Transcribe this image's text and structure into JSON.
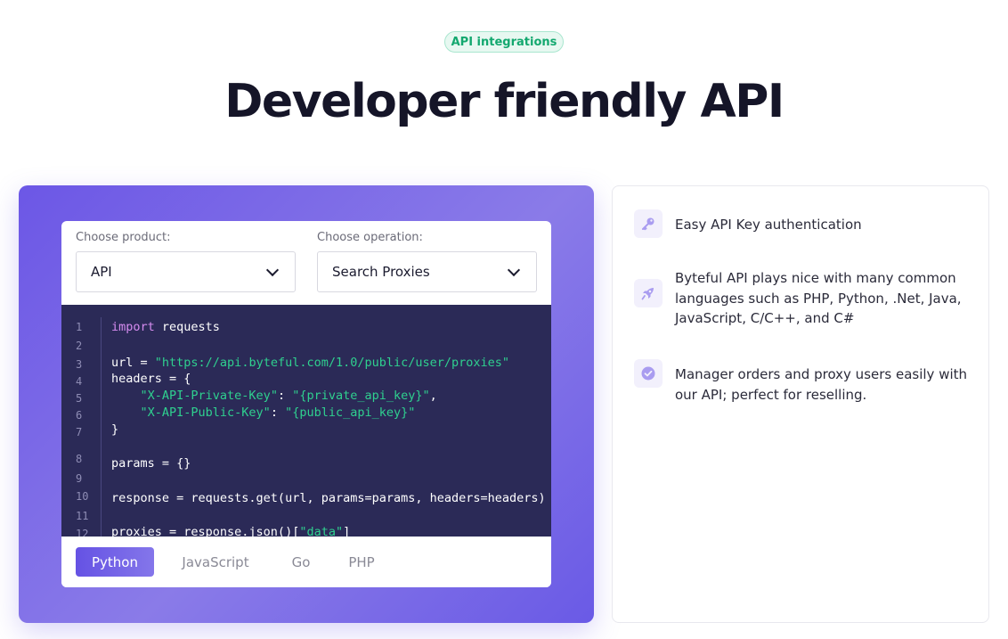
{
  "header": {
    "badge": "API integrations",
    "title": "Developer friendly API"
  },
  "selectors": {
    "product_label": "Choose product:",
    "product_value": "API",
    "operation_label": "Choose operation:",
    "operation_value": "Search Proxies"
  },
  "code": {
    "line_numbers": [
      "1",
      "2",
      "3",
      "4",
      "5",
      "6",
      "7",
      "8",
      "9",
      "10",
      "11",
      "12"
    ],
    "lines": [
      [
        {
          "t": "import",
          "c": "kw"
        },
        {
          "t": " requests",
          "c": ""
        }
      ],
      [],
      [
        {
          "t": "url = ",
          "c": ""
        },
        {
          "t": "\"https://api.byteful.com/1.0/public/user/proxies\"",
          "c": "str"
        }
      ],
      [
        {
          "t": "headers = {",
          "c": ""
        }
      ],
      [
        {
          "t": "    ",
          "c": ""
        },
        {
          "t": "\"X-API-Private-Key\"",
          "c": "str"
        },
        {
          "t": ": ",
          "c": ""
        },
        {
          "t": "\"{private_api_key}\"",
          "c": "str"
        },
        {
          "t": ",",
          "c": ""
        }
      ],
      [
        {
          "t": "    ",
          "c": ""
        },
        {
          "t": "\"X-API-Public-Key\"",
          "c": "str"
        },
        {
          "t": ": ",
          "c": ""
        },
        {
          "t": "\"{public_api_key}\"",
          "c": "str"
        }
      ],
      [
        {
          "t": "}",
          "c": ""
        }
      ],
      [
        {
          "t": "params = {}",
          "c": ""
        }
      ],
      [],
      [
        {
          "t": "response = requests.get(url, params=params, headers=headers)",
          "c": ""
        }
      ],
      [],
      [
        {
          "t": "proxies = response.json()[",
          "c": ""
        },
        {
          "t": "\"data\"",
          "c": "str"
        },
        {
          "t": "]",
          "c": ""
        }
      ]
    ]
  },
  "language_tabs": [
    {
      "label": "Python",
      "active": true
    },
    {
      "label": "JavaScript",
      "active": false
    },
    {
      "label": "Go",
      "active": false
    },
    {
      "label": "PHP",
      "active": false
    }
  ],
  "features": [
    {
      "icon": "key-icon",
      "text": "Easy API Key authentication"
    },
    {
      "icon": "rocket-icon",
      "text": "Byteful API plays nice with many common languages such as PHP, Python, .Net, Java, JavaScript, C/C++, and C#"
    },
    {
      "icon": "check-circle-icon",
      "text": "Manager orders and proxy users easily with our API; perfect for reselling."
    }
  ],
  "colors": {
    "accent": "#6c57e6",
    "badge_green": "#13a86f",
    "code_bg": "#2b2a57",
    "keyword": "#d68cf0",
    "string": "#2fd08f"
  }
}
